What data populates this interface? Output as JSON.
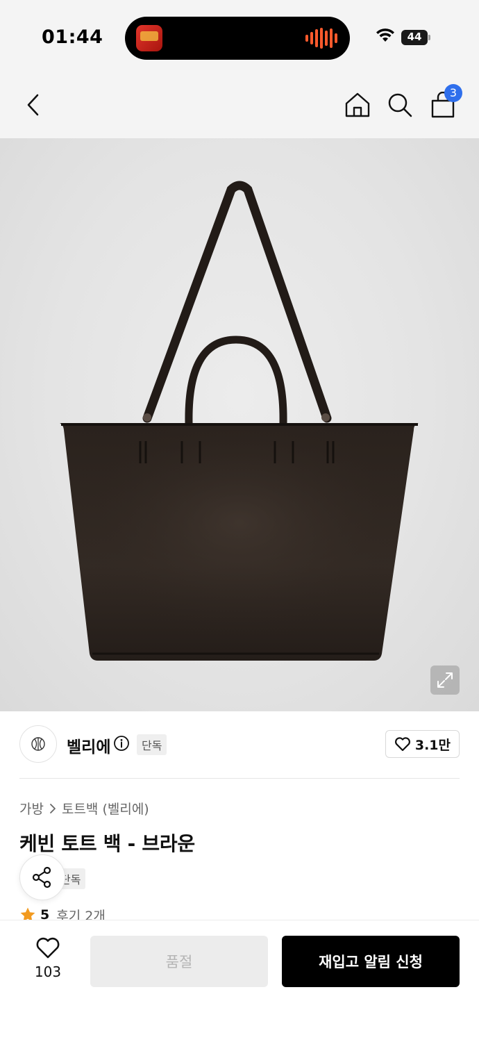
{
  "status_bar": {
    "time": "01:44",
    "battery": "44"
  },
  "nav": {
    "cart_count": "3"
  },
  "brand": {
    "name": "벨리에",
    "tag": "단독",
    "like_count": "3.1만"
  },
  "breadcrumb": {
    "category": "가방",
    "subcategory": "토트백 (벨리에)"
  },
  "product": {
    "title": "케빈 토트 백 - 브라운",
    "tag": "단독",
    "rating": "5",
    "reviews": "후기 2개"
  },
  "bottom_bar": {
    "wish_count": "103",
    "soldout_label": "품절",
    "restock_label": "재입고 알림 신청"
  },
  "colors": {
    "accent_badge": "#2f6fec",
    "star": "#f29a1f",
    "primary_button": "#000000"
  }
}
